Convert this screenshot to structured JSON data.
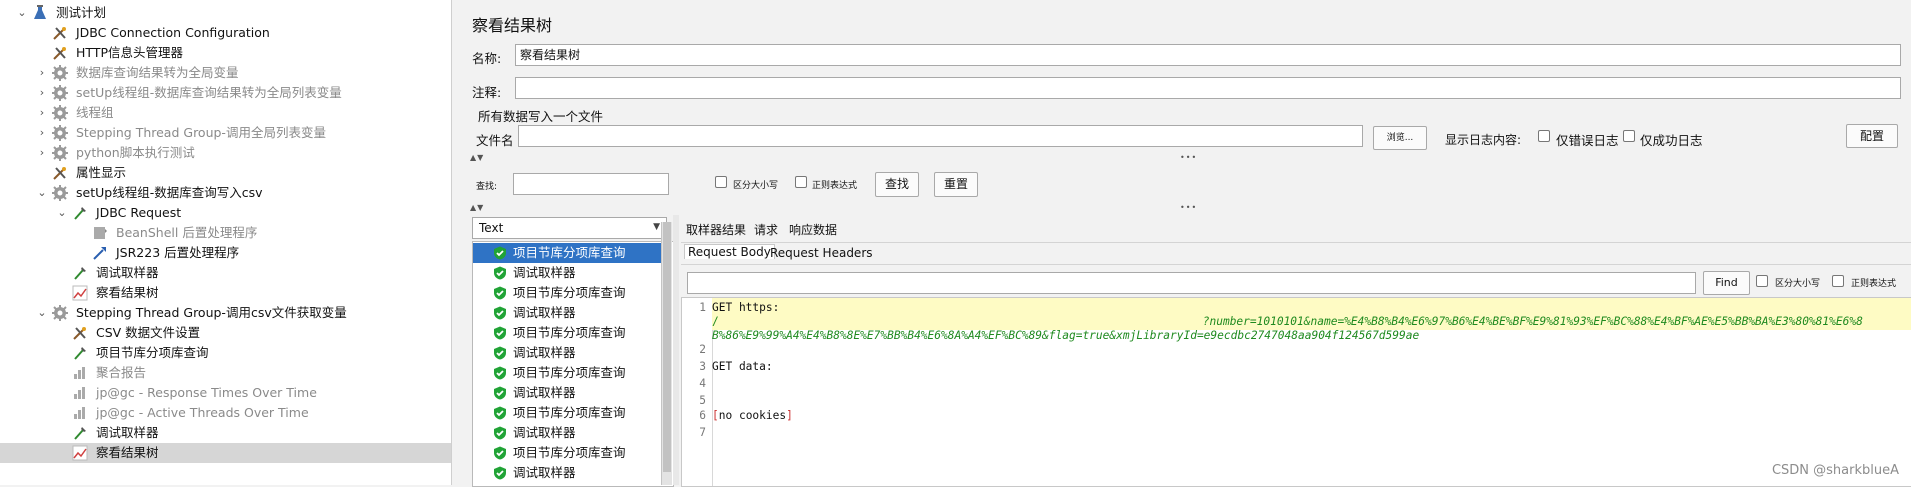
{
  "tree": {
    "items": [
      {
        "label": "测试计划",
        "icon": "test-plan-icon",
        "expander": "⌄",
        "disabled": false
      },
      {
        "label": "JDBC Connection Configuration",
        "icon": "config-element-icon",
        "expander": "",
        "disabled": false
      },
      {
        "label": "HTTP信息头管理器",
        "icon": "config-element-icon",
        "expander": "",
        "disabled": false
      },
      {
        "label": "数据库查询结果转为全局变量",
        "icon": "thread-group-gear-icon",
        "expander": "›",
        "disabled": true
      },
      {
        "label": "setUp线程组-数据库查询结果转为全局列表变量",
        "icon": "thread-group-gear-icon",
        "expander": "›",
        "disabled": true
      },
      {
        "label": "线程组",
        "icon": "thread-group-gear-icon",
        "expander": "›",
        "disabled": true
      },
      {
        "label": "Stepping Thread Group-调用全局列表变量",
        "icon": "thread-group-gear-icon",
        "expander": "›",
        "disabled": true
      },
      {
        "label": "python脚本执行测试",
        "icon": "thread-group-gear-icon",
        "expander": "›",
        "disabled": true
      },
      {
        "label": "属性显示",
        "icon": "config-element-icon",
        "expander": "",
        "disabled": false
      },
      {
        "label": "setUp线程组-数据库查询写入csv",
        "icon": "thread-group-gear-icon",
        "expander": "⌄",
        "disabled": false
      },
      {
        "label": "JDBC Request",
        "icon": "sampler-pipette-icon",
        "expander": "⌄",
        "disabled": false
      },
      {
        "label": "BeanShell 后置处理程序",
        "icon": "post-processor-icon",
        "expander": "",
        "disabled": true
      },
      {
        "label": "JSR223 后置处理程序",
        "icon": "post-processor-arrow-icon",
        "expander": "",
        "disabled": false
      },
      {
        "label": "调试取样器",
        "icon": "sampler-pipette-icon",
        "expander": "",
        "disabled": false
      },
      {
        "label": "察看结果树",
        "icon": "listener-graph-icon",
        "expander": "",
        "disabled": false
      },
      {
        "label": "Stepping Thread Group-调用csv文件获取变量",
        "icon": "thread-group-gear-icon",
        "expander": "⌄",
        "disabled": false
      },
      {
        "label": "CSV 数据文件设置",
        "icon": "config-element-icon",
        "expander": "",
        "disabled": false
      },
      {
        "label": "项目节库分项库查询",
        "icon": "sampler-pipette-icon",
        "expander": "",
        "disabled": false
      },
      {
        "label": "聚合报告",
        "icon": "listener-chart-icon",
        "expander": "",
        "disabled": true
      },
      {
        "label": "jp@gc - Response Times Over Time",
        "icon": "listener-chart-icon",
        "expander": "",
        "disabled": true
      },
      {
        "label": "jp@gc - Active Threads Over Time",
        "icon": "listener-chart-icon",
        "expander": "",
        "disabled": true
      },
      {
        "label": "调试取样器",
        "icon": "sampler-pipette-icon",
        "expander": "",
        "disabled": false
      },
      {
        "label": "察看结果树",
        "icon": "listener-graph-icon",
        "expander": "",
        "disabled": false,
        "selected": true
      }
    ]
  },
  "panel": {
    "title": "察看结果树",
    "name_label": "名称:",
    "name_value": "察看结果树",
    "comment_label": "注释:",
    "comment_value": "",
    "file_section": "所有数据写入一个文件",
    "filename_label": "文件名",
    "filename_value": "",
    "browse_button": "浏览...",
    "log_label": "显示日志内容:",
    "errors_only": "仅错误日志",
    "success_only": "仅成功日志",
    "configure_button": "配置"
  },
  "search": {
    "label": "查找:",
    "value": "",
    "case_sensitive": "区分大小写",
    "regex": "正则表达式",
    "find_button": "查找",
    "reset_button": "重置"
  },
  "renderer": {
    "selected": "Text"
  },
  "results": [
    {
      "label": "项目节库分项库查询",
      "selected": true
    },
    {
      "label": "调试取样器"
    },
    {
      "label": "项目节库分项库查询"
    },
    {
      "label": "调试取样器"
    },
    {
      "label": "项目节库分项库查询"
    },
    {
      "label": "调试取样器"
    },
    {
      "label": "项目节库分项库查询"
    },
    {
      "label": "调试取样器"
    },
    {
      "label": "项目节库分项库查询"
    },
    {
      "label": "调试取样器"
    },
    {
      "label": "项目节库分项库查询"
    },
    {
      "label": "调试取样器"
    }
  ],
  "detail_tabs": [
    "取样器结果",
    "请求",
    "响应数据"
  ],
  "request_tabs": [
    "Request Body",
    "Request Headers"
  ],
  "body_find": {
    "value": "",
    "find_button": "Find",
    "case_sensitive": "区分大小写",
    "regex": "正则表达式"
  },
  "code": {
    "line_numbers": [
      "1",
      "",
      "2",
      "3",
      "4",
      "5",
      "6",
      "7"
    ],
    "line1_prefix": "GET https:",
    "line1b_slash": "/",
    "line1b_query": "?number=1010101&name=%E4%B8%B4%E6%97%B6%E4%BE%BF%E9%81%93%EF%BC%88%E4%BF%AE%E5%BB%BA%E3%80%81%E6%8",
    "line1c": "B%86%E9%99%A4%E4%B8%8E%E7%BB%B4%E6%8A%A4%EF%BC%89&flag=true&xmjLibraryId=e9ecdbc2747048aa904f124567d599ae",
    "line3": "GET data:",
    "line6_open": "[",
    "line6_text": "no cookies",
    "line6_close": "]"
  },
  "watermark": "CSDN @sharkblueA",
  "colors": {
    "selection": "#2f73c5",
    "highlight": "#fefbc4",
    "link_green": "#1f8a1f",
    "success_green": "#21a336"
  }
}
